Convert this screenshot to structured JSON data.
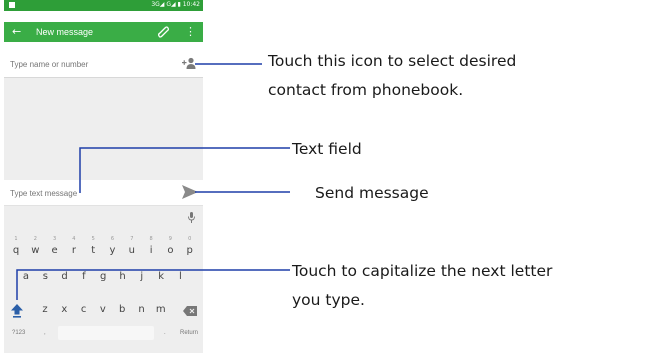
{
  "status_bar": {
    "network_text": "3G◢ G◢ ▮ 10:42"
  },
  "action_bar": {
    "title": "New message",
    "back_icon": "arrow-back-icon",
    "attach_icon": "paperclip-icon",
    "menu_icon": "overflow-menu-icon"
  },
  "recipient": {
    "placeholder": "Type name or number",
    "contact_icon": "add-contact-icon"
  },
  "compose": {
    "placeholder": "Type text message",
    "send_icon": "send-icon"
  },
  "keyboard": {
    "row1": [
      {
        "key": "q",
        "hint": "1"
      },
      {
        "key": "w",
        "hint": "2"
      },
      {
        "key": "e",
        "hint": "3"
      },
      {
        "key": "r",
        "hint": "4"
      },
      {
        "key": "t",
        "hint": "5"
      },
      {
        "key": "y",
        "hint": "6"
      },
      {
        "key": "u",
        "hint": "7"
      },
      {
        "key": "i",
        "hint": "8"
      },
      {
        "key": "o",
        "hint": "9"
      },
      {
        "key": "p",
        "hint": "0"
      }
    ],
    "row2": [
      "a",
      "s",
      "d",
      "f",
      "g",
      "h",
      "j",
      "k",
      "l"
    ],
    "row3": [
      "z",
      "x",
      "c",
      "v",
      "b",
      "n",
      "m"
    ],
    "symbols_label": "?123",
    "comma_label": ",",
    "period_label": ".",
    "return_label": "Return"
  },
  "annotations": {
    "contact_line1": "Touch this icon to select desired",
    "contact_line2": "contact from phonebook.",
    "text_field": "Text field",
    "send_message": "Send message",
    "shift_line1": "Touch to capitalize the next letter",
    "shift_line2": "you type."
  },
  "colors": {
    "status_bar": "#2e9e38",
    "action_bar": "#3aad46",
    "callout_line": "#1f3fa8"
  }
}
